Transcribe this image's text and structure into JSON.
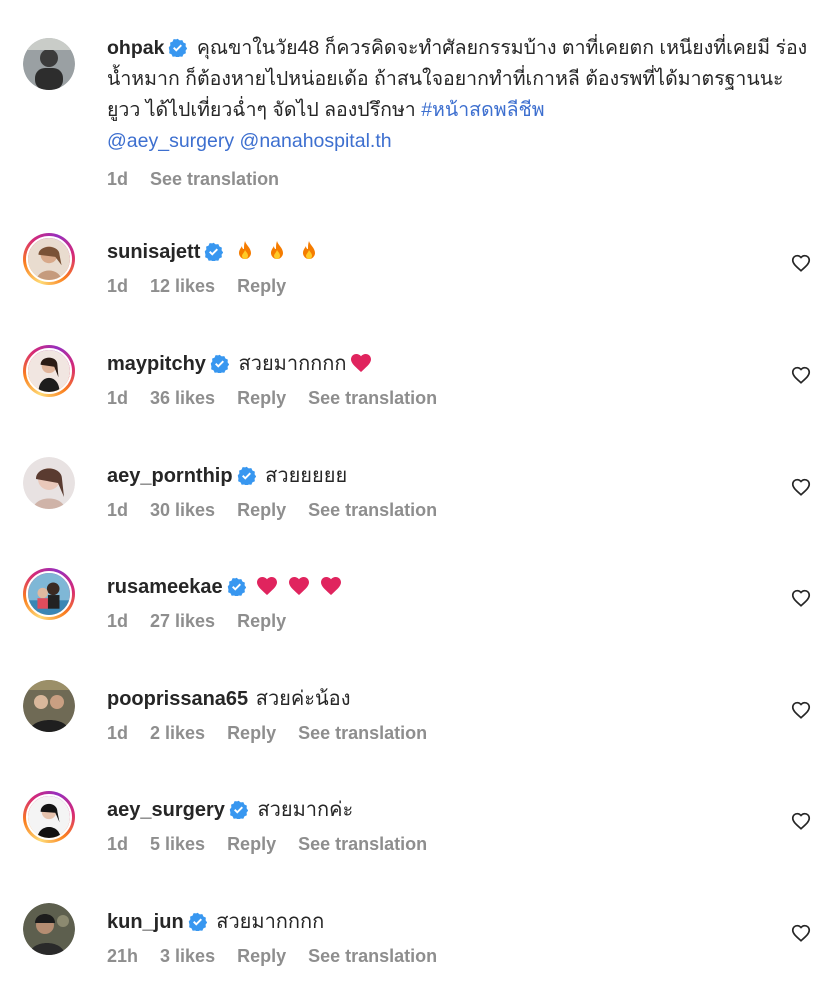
{
  "caption": {
    "username": "ohpak",
    "text": "คุณขาในวัย48 ก็ควรคิดจะทำศัลยกรรมบ้าง ตาที่เคยตก เหนียงที่เคยมี ร่องน้ำหมาก ก็ต้องหายไปหน่อยเด้อ ถ้าสนใจอยากทำที่เกาหลี ต้องรพที่ได้มาตรฐานนะยูวว ได้ไปเที่ยวฉ่ำๆ จัดไป ลองปรึกษา",
    "hashtag": "#หน้าสดพลีชีพ",
    "mentions": "@aey_surgery @nanahospital.th",
    "time": "1d",
    "translate": "See translation"
  },
  "comments": [
    {
      "username": "sunisajett",
      "verified": true,
      "text": "",
      "emoji": [
        "fire",
        "fire",
        "fire"
      ],
      "time": "1d",
      "likes": "12 likes",
      "reply": "Reply",
      "translate": ""
    },
    {
      "username": "maypitchy",
      "verified": true,
      "text": "สวยมากกกก",
      "emoji": [
        "red-heart"
      ],
      "time": "1d",
      "likes": "36 likes",
      "reply": "Reply",
      "translate": "See translation"
    },
    {
      "username": "aey_pornthip",
      "verified": true,
      "text": "สวยยยยย",
      "emoji": [],
      "time": "1d",
      "likes": "30 likes",
      "reply": "Reply",
      "translate": "See translation"
    },
    {
      "username": "rusameekae",
      "verified": true,
      "text": "",
      "emoji": [
        "red-heart",
        "red-heart",
        "red-heart"
      ],
      "time": "1d",
      "likes": "27 likes",
      "reply": "Reply",
      "translate": ""
    },
    {
      "username": "pooprissana65",
      "verified": false,
      "text": "สวยค่ะน้อง",
      "emoji": [],
      "time": "1d",
      "likes": "2 likes",
      "reply": "Reply",
      "translate": "See translation"
    },
    {
      "username": "aey_surgery",
      "verified": true,
      "text": "สวยมากค่ะ",
      "emoji": [],
      "time": "1d",
      "likes": "5 likes",
      "reply": "Reply",
      "translate": "See translation"
    },
    {
      "username": "kun_jun",
      "verified": true,
      "text": "สวยมากกกก",
      "emoji": [],
      "time": "21h",
      "likes": "3 likes",
      "reply": "Reply",
      "translate": "See translation"
    }
  ],
  "colors": {
    "verified": "#3897f0",
    "link": "#3d6fcf",
    "muted": "#8e8e8e"
  }
}
